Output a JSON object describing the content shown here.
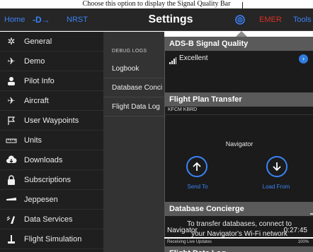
{
  "caption": "Choose this option to display the Signal Quality Bar",
  "topbar": {
    "home": "Home",
    "direct_to": "-D→",
    "nrst": "NRST",
    "title": "Settings",
    "emer": "EMER",
    "tools": "Tools",
    "status_icon": "wifi-broadcast-icon"
  },
  "sidebar": {
    "items": [
      {
        "label": "General",
        "icon": "gear-icon"
      },
      {
        "label": "Demo",
        "icon": "airplane-icon"
      },
      {
        "label": "Pilot Info",
        "icon": "person-icon"
      },
      {
        "label": "Aircraft",
        "icon": "airplane-icon"
      },
      {
        "label": "User Waypoints",
        "icon": "flag-icon"
      },
      {
        "label": "Units",
        "icon": "ruler-icon"
      },
      {
        "label": "Downloads",
        "icon": "cloud-download-icon"
      },
      {
        "label": "Subscriptions",
        "icon": "lock-icon"
      },
      {
        "label": "Jeppesen",
        "icon": "jeppesen-icon"
      },
      {
        "label": "Data Services",
        "icon": "plane-signal-icon"
      },
      {
        "label": "Flight Simulation",
        "icon": "joystick-icon"
      }
    ]
  },
  "middle": {
    "header": "DEBUG LOGS",
    "items": [
      "Logbook",
      "Database Conci",
      "Flight Data Log"
    ]
  },
  "popover": {
    "adsb": {
      "title": "ADS-B Signal Quality",
      "quality": "Excellent"
    },
    "flight_plan": {
      "title": "Flight Plan Transfer",
      "route": "KFCM KBRD",
      "device": "Navigator",
      "send_label": "Send To",
      "load_label": "Load From"
    },
    "database": {
      "title": "Database Concierge",
      "text_line1": "To transfer databases, connect to",
      "text_line2": "your Navigator's Wi-Fi network"
    },
    "flight_data_log": {
      "title": "Flight Data Log",
      "device": "Navigator",
      "time": "0:27:45",
      "status": "Receiving Live Updates",
      "percent": "100%"
    }
  },
  "colors": {
    "accent": "#3b82f6",
    "emergency": "#d93025",
    "section_header": "#5a5a5a",
    "background": "#1f1f1f"
  }
}
